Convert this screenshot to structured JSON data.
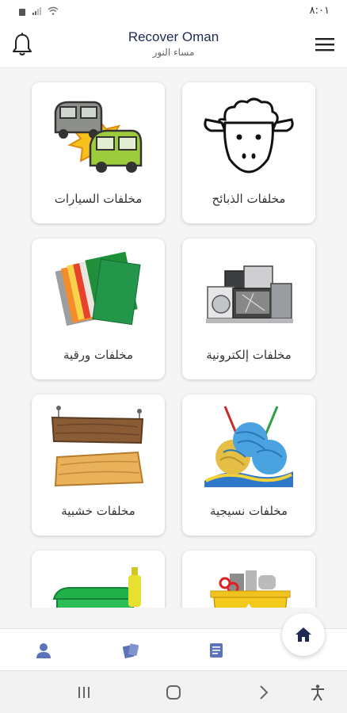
{
  "status_bar": {
    "time": "٨:٠١"
  },
  "header": {
    "title": "Recover Oman",
    "subtitle": "مساء النور"
  },
  "categories": [
    {
      "label": "مخلفات الذبائح",
      "icon": "sheep-icon"
    },
    {
      "label": "مخلفات السيارات",
      "icon": "cars-icon"
    },
    {
      "label": "مخلفات إلكترونية",
      "icon": "electronics-icon"
    },
    {
      "label": "مخلفات ورقية",
      "icon": "paper-icon"
    },
    {
      "label": "مخلفات نسيجية",
      "icon": "yarn-icon"
    },
    {
      "label": "مخلفات خشبية",
      "icon": "wood-planks-icon"
    },
    {
      "label": "",
      "icon": "scrap-bin-icon"
    },
    {
      "label": "",
      "icon": "green-bin-icon"
    }
  ],
  "bottom_nav": {
    "items": [
      "profile-icon",
      "cards-icon",
      "document-icon"
    ],
    "home_icon": "home-icon"
  },
  "colors": {
    "accent": "#1f2a52",
    "nav_icon": "#5b73b8"
  }
}
